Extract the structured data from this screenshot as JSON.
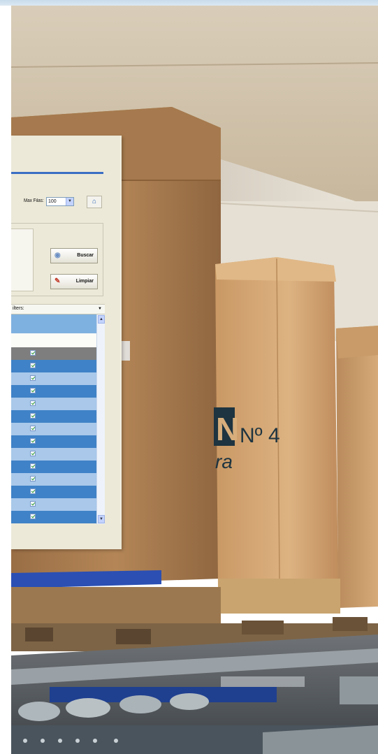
{
  "inset": {
    "max_filas_label": "Max Filas:",
    "max_filas_value": "100",
    "buscar_label": "Buscar",
    "limpiar_label": "Limpiar",
    "filters_label": "ilters:",
    "rows": [
      "gray",
      "dark",
      "light",
      "dark",
      "light",
      "dark",
      "light",
      "dark",
      "light",
      "dark",
      "light",
      "dark",
      "light",
      "dark"
    ]
  },
  "photo": {
    "box_marking_no4": "Nº 4",
    "box_marking_logo": "N",
    "box_marking_ra": "ra"
  },
  "colors": {
    "topbar": "#cfe0ee",
    "row_dark": "#3f82c7",
    "row_light": "#a9c8ea",
    "cardboard": "#b9895b",
    "pallet_band": "#2b4fb3"
  }
}
